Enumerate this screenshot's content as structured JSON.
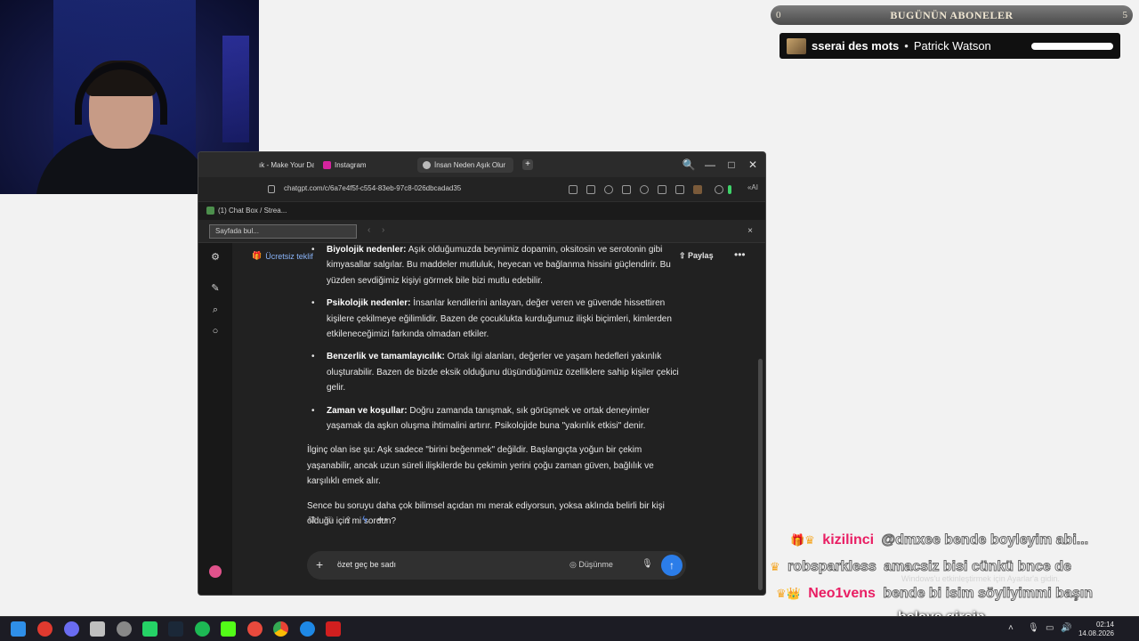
{
  "subs_widget": {
    "title": "BUGÜNÜN ABONELER",
    "left_count": "0",
    "right_count": "5",
    "track_title": "sserai des mots",
    "separator": "•",
    "track_artist": "Patrick Watson"
  },
  "browser": {
    "tabs": [
      {
        "label": "ık - Make Your Da",
        "icon_color": "#e53935"
      },
      {
        "label": "Instagram",
        "icon_color": "#d6249f"
      },
      {
        "label": "İnsan Neden Aşık Olur",
        "icon_color": "#bbbbbb",
        "active": true
      }
    ],
    "new_tab": "+",
    "controls": {
      "search": "🔍",
      "minimize": "—",
      "maximize": "□",
      "close": "✕"
    },
    "url": "chatgpt.com/c/6a7e4f5f-c554-83eb-97c8-026dbcadad35",
    "ai_label": "«AI",
    "chatbox_label": "(1) Chat Box / Strea...",
    "find_placeholder": "Sayfada bul...",
    "find_prev": "‹",
    "find_next": "›",
    "find_close": "×"
  },
  "chatgpt": {
    "offer_label": "Ücretsiz teklif",
    "share_label": "Paylaş",
    "more_label": "•••",
    "bullet_partial": {
      "bold": "Biyolojik nedenler:",
      "text": " Aşık olduğumuzda beynimiz dopamin, oksitosin ve serotonin gibi kimyasallar salgılar. Bu maddeler mutluluk, heyecan ve bağlanma hissini güçlendirir. Bu yüzden sevdiğimiz kişiyi görmek bile bizi mutlu edebilir."
    },
    "bullets": [
      {
        "bold": "Psikolojik nedenler:",
        "text": " İnsanlar kendilerini anlayan, değer veren ve güvende hissettiren kişilere çekilmeye eğilimlidir. Bazen de çocuklukta kurduğumuz ilişki biçimleri, kimlerden etkileneceğimizi farkında olmadan etkiler."
      },
      {
        "bold": "Benzerlik ve tamamlayıcılık:",
        "text": " Ortak ilgi alanları, değerler ve yaşam hedefleri yakınlık oluşturabilir. Bazen de bizde eksik olduğunu düşündüğümüz özelliklere sahip kişiler çekici gelir."
      },
      {
        "bold": "Zaman ve koşullar:",
        "text": " Doğru zamanda tanışmak, sık görüşmek ve ortak deneyimler yaşamak da aşkın oluşma ihtimalini artırır. Psikolojide buna \"yakınlık etkisi\" denir."
      }
    ],
    "para1": "İlginç olan ise şu: Aşk sadece \"birini beğenmek\" değildir. Başlangıçta yoğun bir çekim yaşanabilir, ancak uzun süreli ilişkilerde bu çekimin yerini çoğu zaman güven, bağlılık ve karşılıklı emek alır.",
    "para2": "Sence bu soruyu daha çok bilimsel açıdan mı merak ediyorsun, yoksa aklında belirli bir kişi olduğu için mi sordun?",
    "composer_text": "özet geç be sadı",
    "think_label": "Düşünme",
    "plus": "+",
    "send": "↑",
    "mic": "🎙"
  },
  "stream_chat": [
    {
      "badge": "🎁♛",
      "user": "kizilinci",
      "user_color": "#e91e63",
      "message": "@dmxee bende boyleyim abi..."
    },
    {
      "badge": "♛",
      "user": "robsparkless",
      "user_color": "#ffffff",
      "message": "amacsiz bisi cünkü bnce de"
    },
    {
      "badge": "♛👑",
      "user": "Neo1vens",
      "user_color": "#e91e63",
      "message": "bende bi isim söyliyimmi başın"
    },
    {
      "badge": "",
      "user": "",
      "user_color": "#ffffff",
      "message": "belaya girsin"
    }
  ],
  "watermark": "Windows'u etkinleştirmek için Ayarlar'a gidin.",
  "taskbar": {
    "time": "02:14",
    "date": "14.08.2026"
  }
}
